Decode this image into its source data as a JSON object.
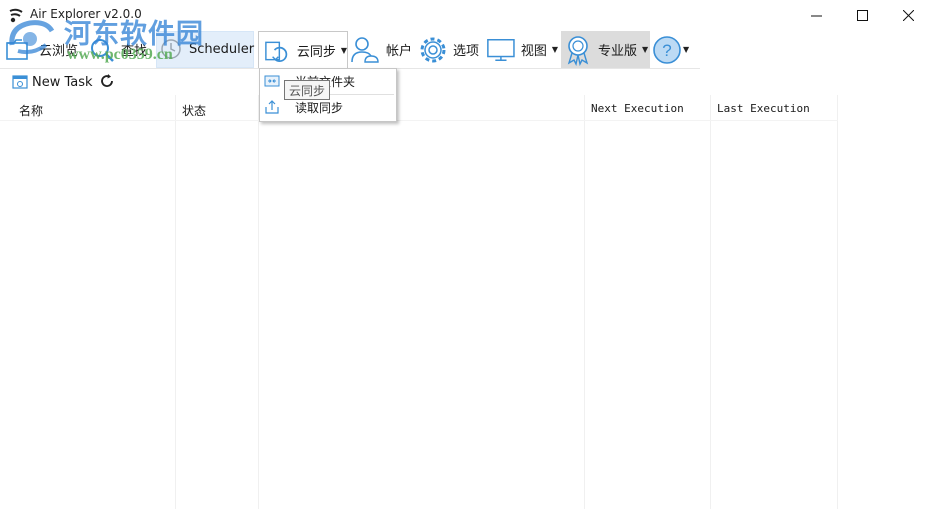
{
  "window": {
    "title": "Air Explorer v2.0.0",
    "controls": {
      "minimize": "—",
      "maximize": "☐",
      "close": "✕"
    }
  },
  "watermark": {
    "site_name": "河东软件园",
    "url": "www.pc0359.cn"
  },
  "toolbar": {
    "browse_label": "云浏览",
    "search_label": "查找",
    "scheduler_label": "Scheduler",
    "sync_label": "云同步",
    "account_label": "帐户",
    "options_label": "选项",
    "view_label": "视图",
    "pro_label": "专业版",
    "help_caret": "▾"
  },
  "subtoolbar": {
    "new_task_label": "New Task"
  },
  "grid": {
    "columns": [
      "名称",
      "状态",
      "",
      "Next Execution",
      "Last Execution"
    ]
  },
  "sync_menu": {
    "items": [
      {
        "label": "当前文件夹",
        "icon": "sync-folder-icon"
      },
      {
        "label": "读取同步",
        "icon": "upload-sync-icon"
      }
    ],
    "tooltip": "云同步"
  },
  "colors": {
    "accent": "#3a8fd6",
    "selected_bg": "#e3eefa",
    "pro_bg": "#dcdcdc"
  }
}
